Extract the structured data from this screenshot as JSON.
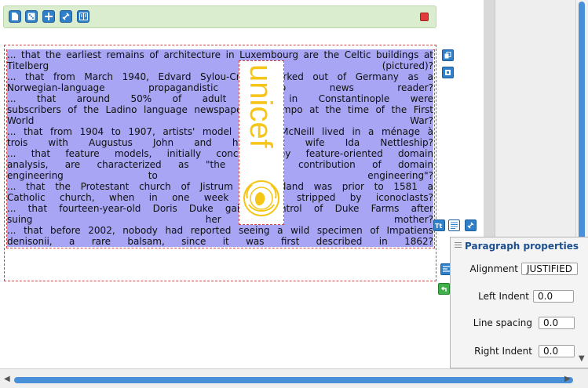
{
  "toolbar": {
    "buttons": [
      "new-page-icon",
      "dice-icon",
      "add-icon",
      "link-icon",
      "columns-icon"
    ],
    "close": "close-icon"
  },
  "document": {
    "lines": [
      "... that the earliest remains of architecture in Luxembourg are the Celtic buildings at",
      "Titelberg                                                (pictured)?",
      "... that from March 1940, Edvard Sylou-Crantz worked out of Germany as a",
      "Norwegian-language propagandistic radio news reader?",
      "... that around 50% of adult Jews in Constantinople were",
      "subscribers of the Ladino language newspaper El Tiempo at the time of the First",
      "World                                                War?",
      "... that from 1904 to 1907, artists' model Dorelia McNeill lived in a ménage à",
      "trois with Augustus John and his first wife Ida Nettleship?",
      "... that feature models, initially conceived by feature-oriented domain",
      "analysis, are characterized as \"the greatest contribution of domain",
      "engineering to software engineering\"?",
      "... that the Protestant church of Jistrum in Friesland was prior to 1581 a",
      "Catholic church, when in one week it was stripped by iconoclasts?",
      "... that fourteen-year-old Doris Duke gained control of Duke Farms after",
      "suing her mother?",
      "... that before 2002, nobody had reported seeing a wild specimen of Impatiens",
      "denisonii, a rare balsam, since it was first described in 1862?"
    ],
    "logo_text": "unicef",
    "logo_color": "#f5c518",
    "highlight_color": "#a7a5f4"
  },
  "side_buttons": {
    "top": [
      "copy-icon",
      "paste-icon"
    ],
    "middle": [
      "text-style-icon",
      "paragraph-icon",
      "link-icon"
    ],
    "lower": [
      "list-icon",
      "undo-icon"
    ]
  },
  "props": {
    "title": "Paragraph properties",
    "alignment_label": "Alignment",
    "alignment_value": "JUSTIFIED",
    "left_indent_label": "Left Indent",
    "left_indent_value": "0.0",
    "line_spacing_label": "Line spacing",
    "line_spacing_value": "0.0",
    "right_indent_label": "Right Indent",
    "right_indent_value": "0.0"
  }
}
